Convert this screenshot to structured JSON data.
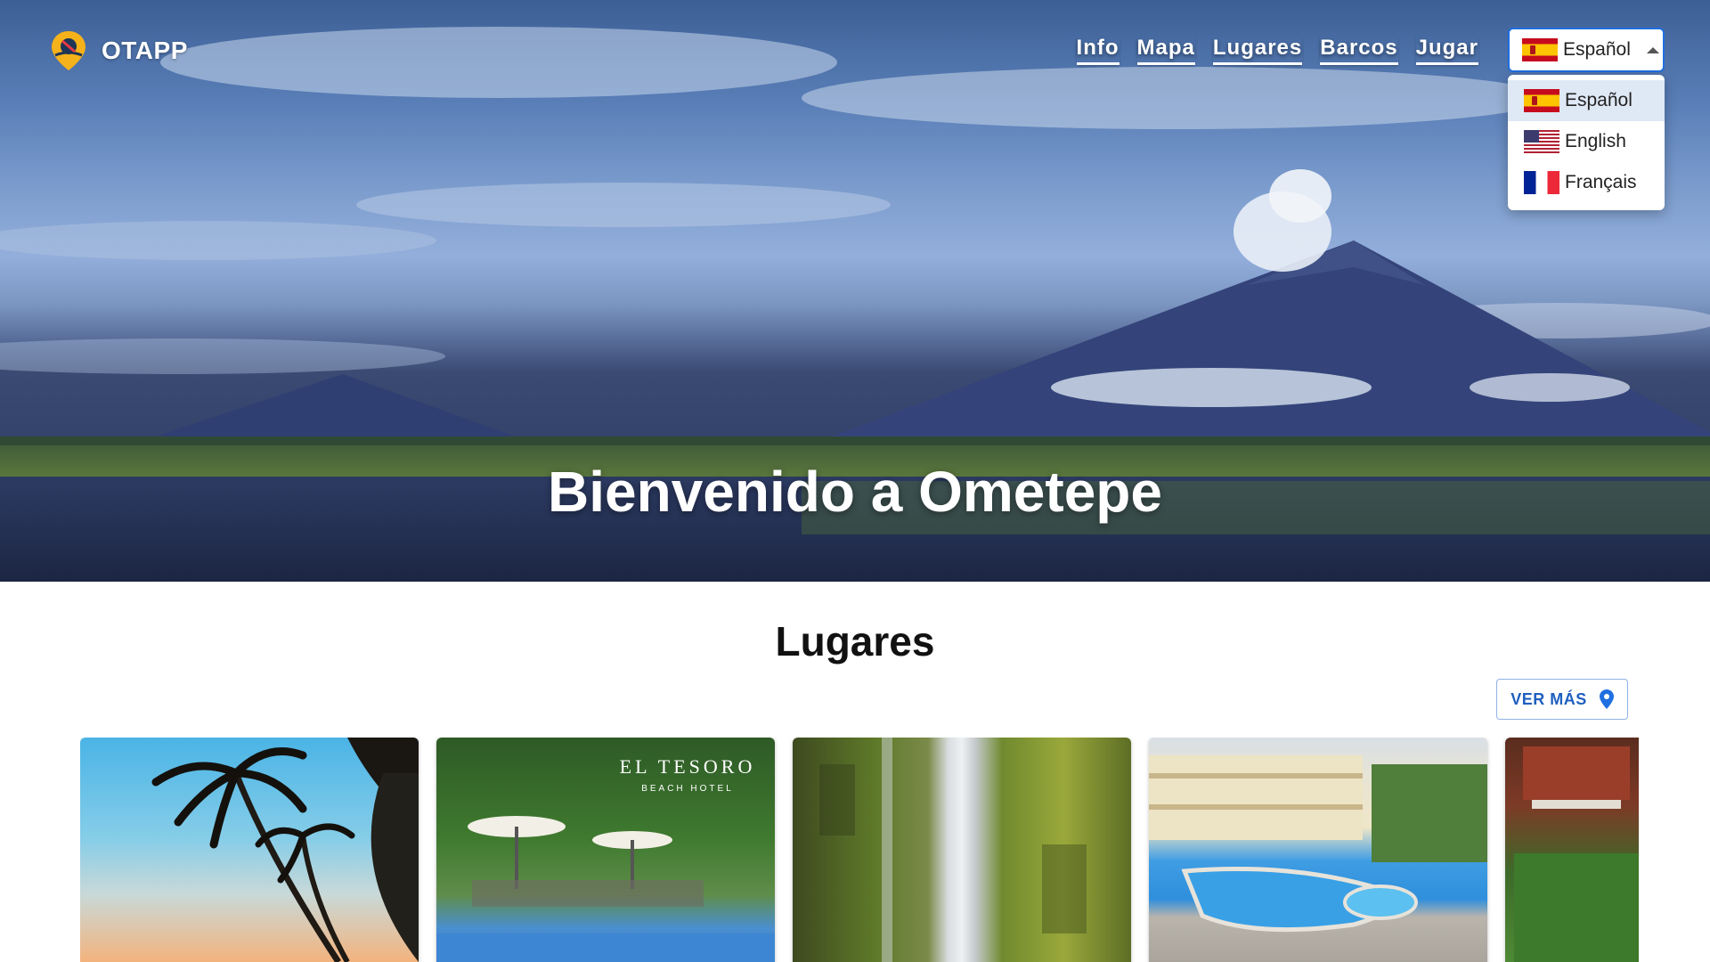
{
  "brand": {
    "name": "OTAPP",
    "logo_icon": "map-pin-sun-icon"
  },
  "nav": [
    {
      "label": "Info"
    },
    {
      "label": "Mapa"
    },
    {
      "label": "Lugares"
    },
    {
      "label": "Barcos"
    },
    {
      "label": "Jugar"
    }
  ],
  "language": {
    "selected": "Español",
    "options": [
      {
        "label": "Español",
        "flag": "spain-flag-icon"
      },
      {
        "label": "English",
        "flag": "usa-flag-icon"
      },
      {
        "label": "Français",
        "flag": "france-flag-icon"
      }
    ]
  },
  "hero": {
    "title": "Bienvenido a Ometepe"
  },
  "places": {
    "title": "Lugares",
    "more_button": "VER MÁS",
    "more_icon": "location-pin-icon",
    "cards": [
      {
        "image": "palm-trees-sunset"
      },
      {
        "image": "el-tesoro-beach-hotel"
      },
      {
        "image": "waterfall"
      },
      {
        "image": "hotel-pool"
      },
      {
        "image": "garden-cabin"
      }
    ],
    "card_logo_text": {
      "line1": "EL TESORO",
      "line2": "BEACH HOTEL"
    }
  },
  "colors": {
    "accent": "#1f6fe0",
    "button_text": "#1f5fbf"
  }
}
